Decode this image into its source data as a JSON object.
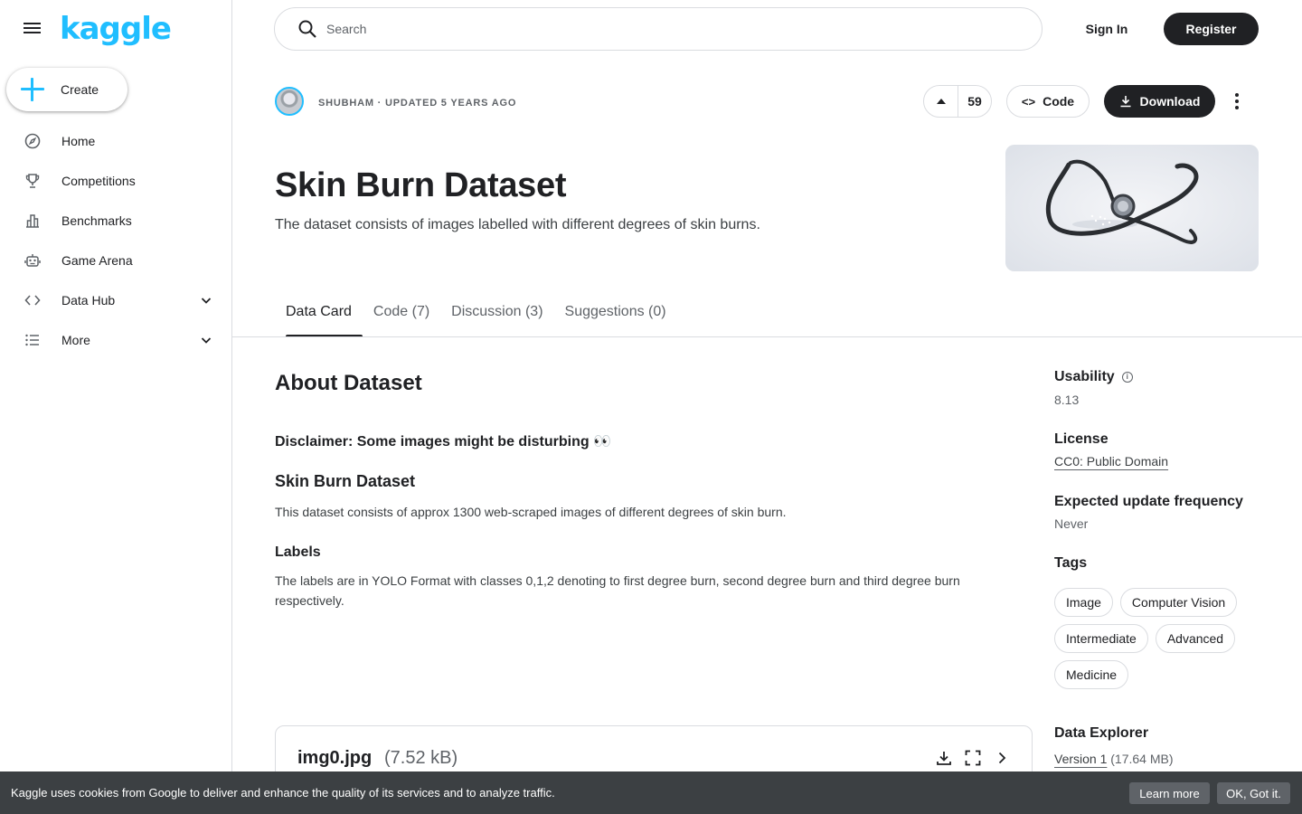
{
  "sidebar": {
    "logo": "kaggle",
    "create_label": "Create",
    "items": [
      {
        "label": "Home",
        "icon": "compass-icon"
      },
      {
        "label": "Competitions",
        "icon": "trophy-icon"
      },
      {
        "label": "Benchmarks",
        "icon": "bar-chart-icon"
      },
      {
        "label": "Game Arena",
        "icon": "robot-icon"
      },
      {
        "label": "Data Hub",
        "icon": "code-brackets-icon"
      },
      {
        "label": "More",
        "icon": "list-icon"
      }
    ]
  },
  "header": {
    "search_placeholder": "Search",
    "sign_in": "Sign In",
    "register": "Register"
  },
  "dataset": {
    "meta": "SHUBHAM · UPDATED 5 YEARS AGO",
    "votes": "59",
    "code_label": "Code",
    "download_label": "Download",
    "title": "Skin Burn Dataset",
    "subtitle": "The dataset consists of images labelled with different degrees of skin burns."
  },
  "tabs": [
    "Data Card",
    "Code (7)",
    "Discussion (3)",
    "Suggestions (0)"
  ],
  "content": {
    "about_heading": "About Dataset",
    "disclaimer": "Disclaimer: Some images might be disturbing 👀",
    "sub_heading": "Skin Burn Dataset",
    "paragraph1": "This dataset consists of approx 1300 web-scraped images of different degrees of skin burn.",
    "labels_heading": "Labels",
    "paragraph2": "The labels are in YOLO Format with classes 0,1,2 denoting to first degree burn, second degree burn and third degree burn respectively."
  },
  "file": {
    "name": "img0.jpg",
    "size": "(7.52 kB)"
  },
  "right_panel": {
    "usability_label": "Usability",
    "usability_value": "8.13",
    "license_label": "License",
    "license_value": "CC0: Public Domain",
    "update_label": "Expected update frequency",
    "update_value": "Never",
    "tags_label": "Tags",
    "tags": [
      "Image",
      "Computer Vision",
      "Intermediate",
      "Advanced",
      "Medicine"
    ],
    "explorer_label": "Data Explorer",
    "version_link": "Version 1",
    "version_size": "(17.64 MB)"
  },
  "cookie": {
    "text": "Kaggle uses cookies from Google to deliver and enhance the quality of its services and to analyze traffic.",
    "learn_more": "Learn more",
    "ok": "OK, Got it."
  },
  "colors": {
    "accent": "#20beff",
    "dark": "#202124",
    "cookie_bg": "#3c4043"
  }
}
